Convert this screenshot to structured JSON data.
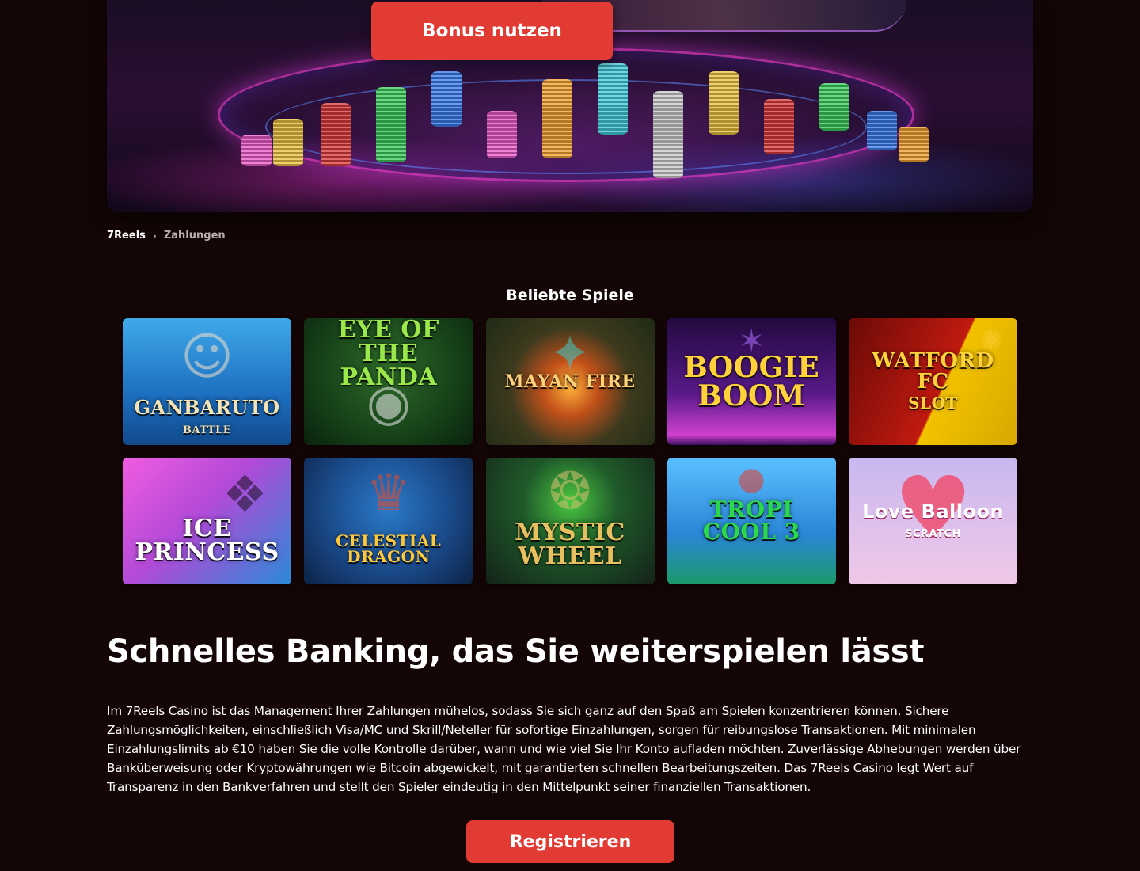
{
  "hero": {
    "bonus_button_label": "Bonus nutzen"
  },
  "breadcrumb": {
    "home": "7Reels",
    "separator": "›",
    "current": "Zahlungen"
  },
  "games": {
    "title": "Beliebte Spiele",
    "items": [
      {
        "name": "GANBARUTO",
        "subtitle": "BATTLE",
        "icon": "wrestler-icon"
      },
      {
        "name": "EYE OF THE PANDA",
        "subtitle": "",
        "icon": "panda-icon"
      },
      {
        "name": "MAYAN FIRE",
        "subtitle": "",
        "icon": "mayan-warrior-icon"
      },
      {
        "name": "BOOGIE BOOM",
        "subtitle": "",
        "icon": "disco-icon"
      },
      {
        "name": "WATFORD FC",
        "subtitle": "SLOT",
        "icon": "football-icon"
      },
      {
        "name": "ICE PRINCESS",
        "subtitle": "",
        "icon": "princess-icon"
      },
      {
        "name": "CELESTIAL DRAGON",
        "subtitle": "",
        "icon": "dragon-icon"
      },
      {
        "name": "MYSTIC WHEEL",
        "subtitle": "",
        "icon": "wheel-icon"
      },
      {
        "name": "TROPI COOL 3",
        "subtitle": "",
        "icon": "tropical-icon"
      },
      {
        "name": "Love Balloon",
        "subtitle": "SCRATCH",
        "icon": "heart-balloon-icon"
      }
    ]
  },
  "article": {
    "heading": "Schnelles Banking, das Sie weiterspielen lässt",
    "body": "Im 7Reels Casino ist das Management Ihrer Zahlungen mühelos, sodass Sie sich ganz auf den Spaß am Spielen konzentrieren können. Sichere Zahlungsmöglichkeiten, einschließlich Visa/MC und Skrill/Neteller für sofortige Einzahlungen, sorgen für reibungslose Transaktionen. Mit minimalen Einzahlungslimits ab €10 haben Sie die volle Kontrolle darüber, wann und wie viel Sie Ihr Konto aufladen möchten. Zuverlässige Abhebungen werden über Banküberweisung oder Kryptowährungen wie Bitcoin abgewickelt, mit garantierten schnellen Bearbeitungszeiten. Das 7Reels Casino legt Wert auf Transparenz in den Bankverfahren und stellt den Spieler eindeutig in den Mittelpunkt seiner finanziellen Transaktionen.",
    "register_button_label": "Registrieren"
  },
  "colors": {
    "background": "#140506",
    "accent": "#e23b34"
  }
}
